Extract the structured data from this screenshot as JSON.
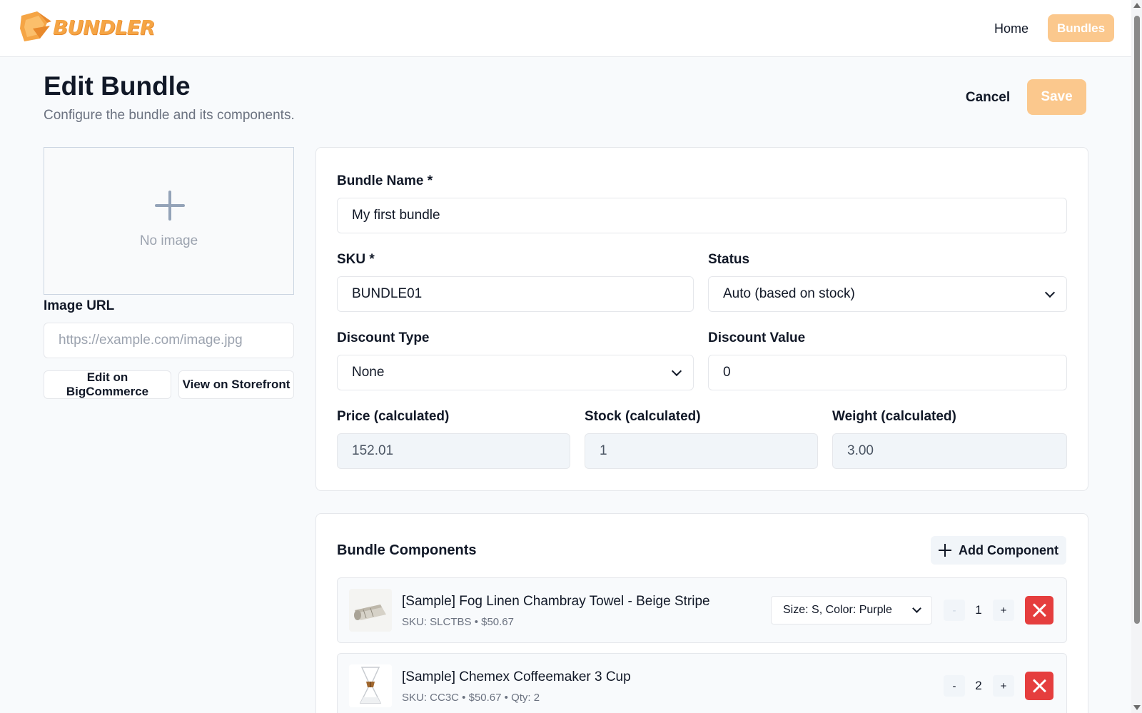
{
  "header": {
    "logo_text": "BUNDLER",
    "nav": {
      "home_label": "Home",
      "bundles_label": "Bundles"
    }
  },
  "page": {
    "title": "Edit Bundle",
    "subtitle": "Configure the bundle and its components.",
    "cancel_label": "Cancel",
    "save_label": "Save"
  },
  "image": {
    "placeholder_text": "No image",
    "url_label": "Image URL",
    "url_placeholder": "https://example.com/image.jpg",
    "edit_label": "Edit on BigCommerce",
    "view_label": "View on Storefront"
  },
  "form": {
    "name_label": "Bundle Name *",
    "name_value": "My first bundle",
    "sku_label": "SKU *",
    "sku_value": "BUNDLE01",
    "status_label": "Status",
    "status_value": "Auto (based on stock)",
    "discount_type_label": "Discount Type",
    "discount_type_value": "None",
    "discount_value_label": "Discount Value",
    "discount_value": "0",
    "price_label": "Price (calculated)",
    "price_value": "152.01",
    "stock_label": "Stock (calculated)",
    "stock_value": "1",
    "weight_label": "Weight (calculated)",
    "weight_value": "3.00"
  },
  "components": {
    "title": "Bundle Components",
    "add_label": "Add Component",
    "items": [
      {
        "name": "[Sample] Fog Linen Chambray Towel - Beige Stripe",
        "meta": "SKU: SLCTBS • $50.67",
        "variant": "Size: S, Color: Purple",
        "qty": "1",
        "minus": "-",
        "plus": "+"
      },
      {
        "name": "[Sample] Chemex Coffeemaker 3 Cup",
        "meta": "SKU: CC3C • $50.67 • Qty: 2",
        "qty": "2",
        "minus": "-",
        "plus": "+"
      }
    ]
  },
  "colors": {
    "accent": "#fbc88d",
    "danger": "#e53e3e",
    "logo": "#f5a545"
  }
}
